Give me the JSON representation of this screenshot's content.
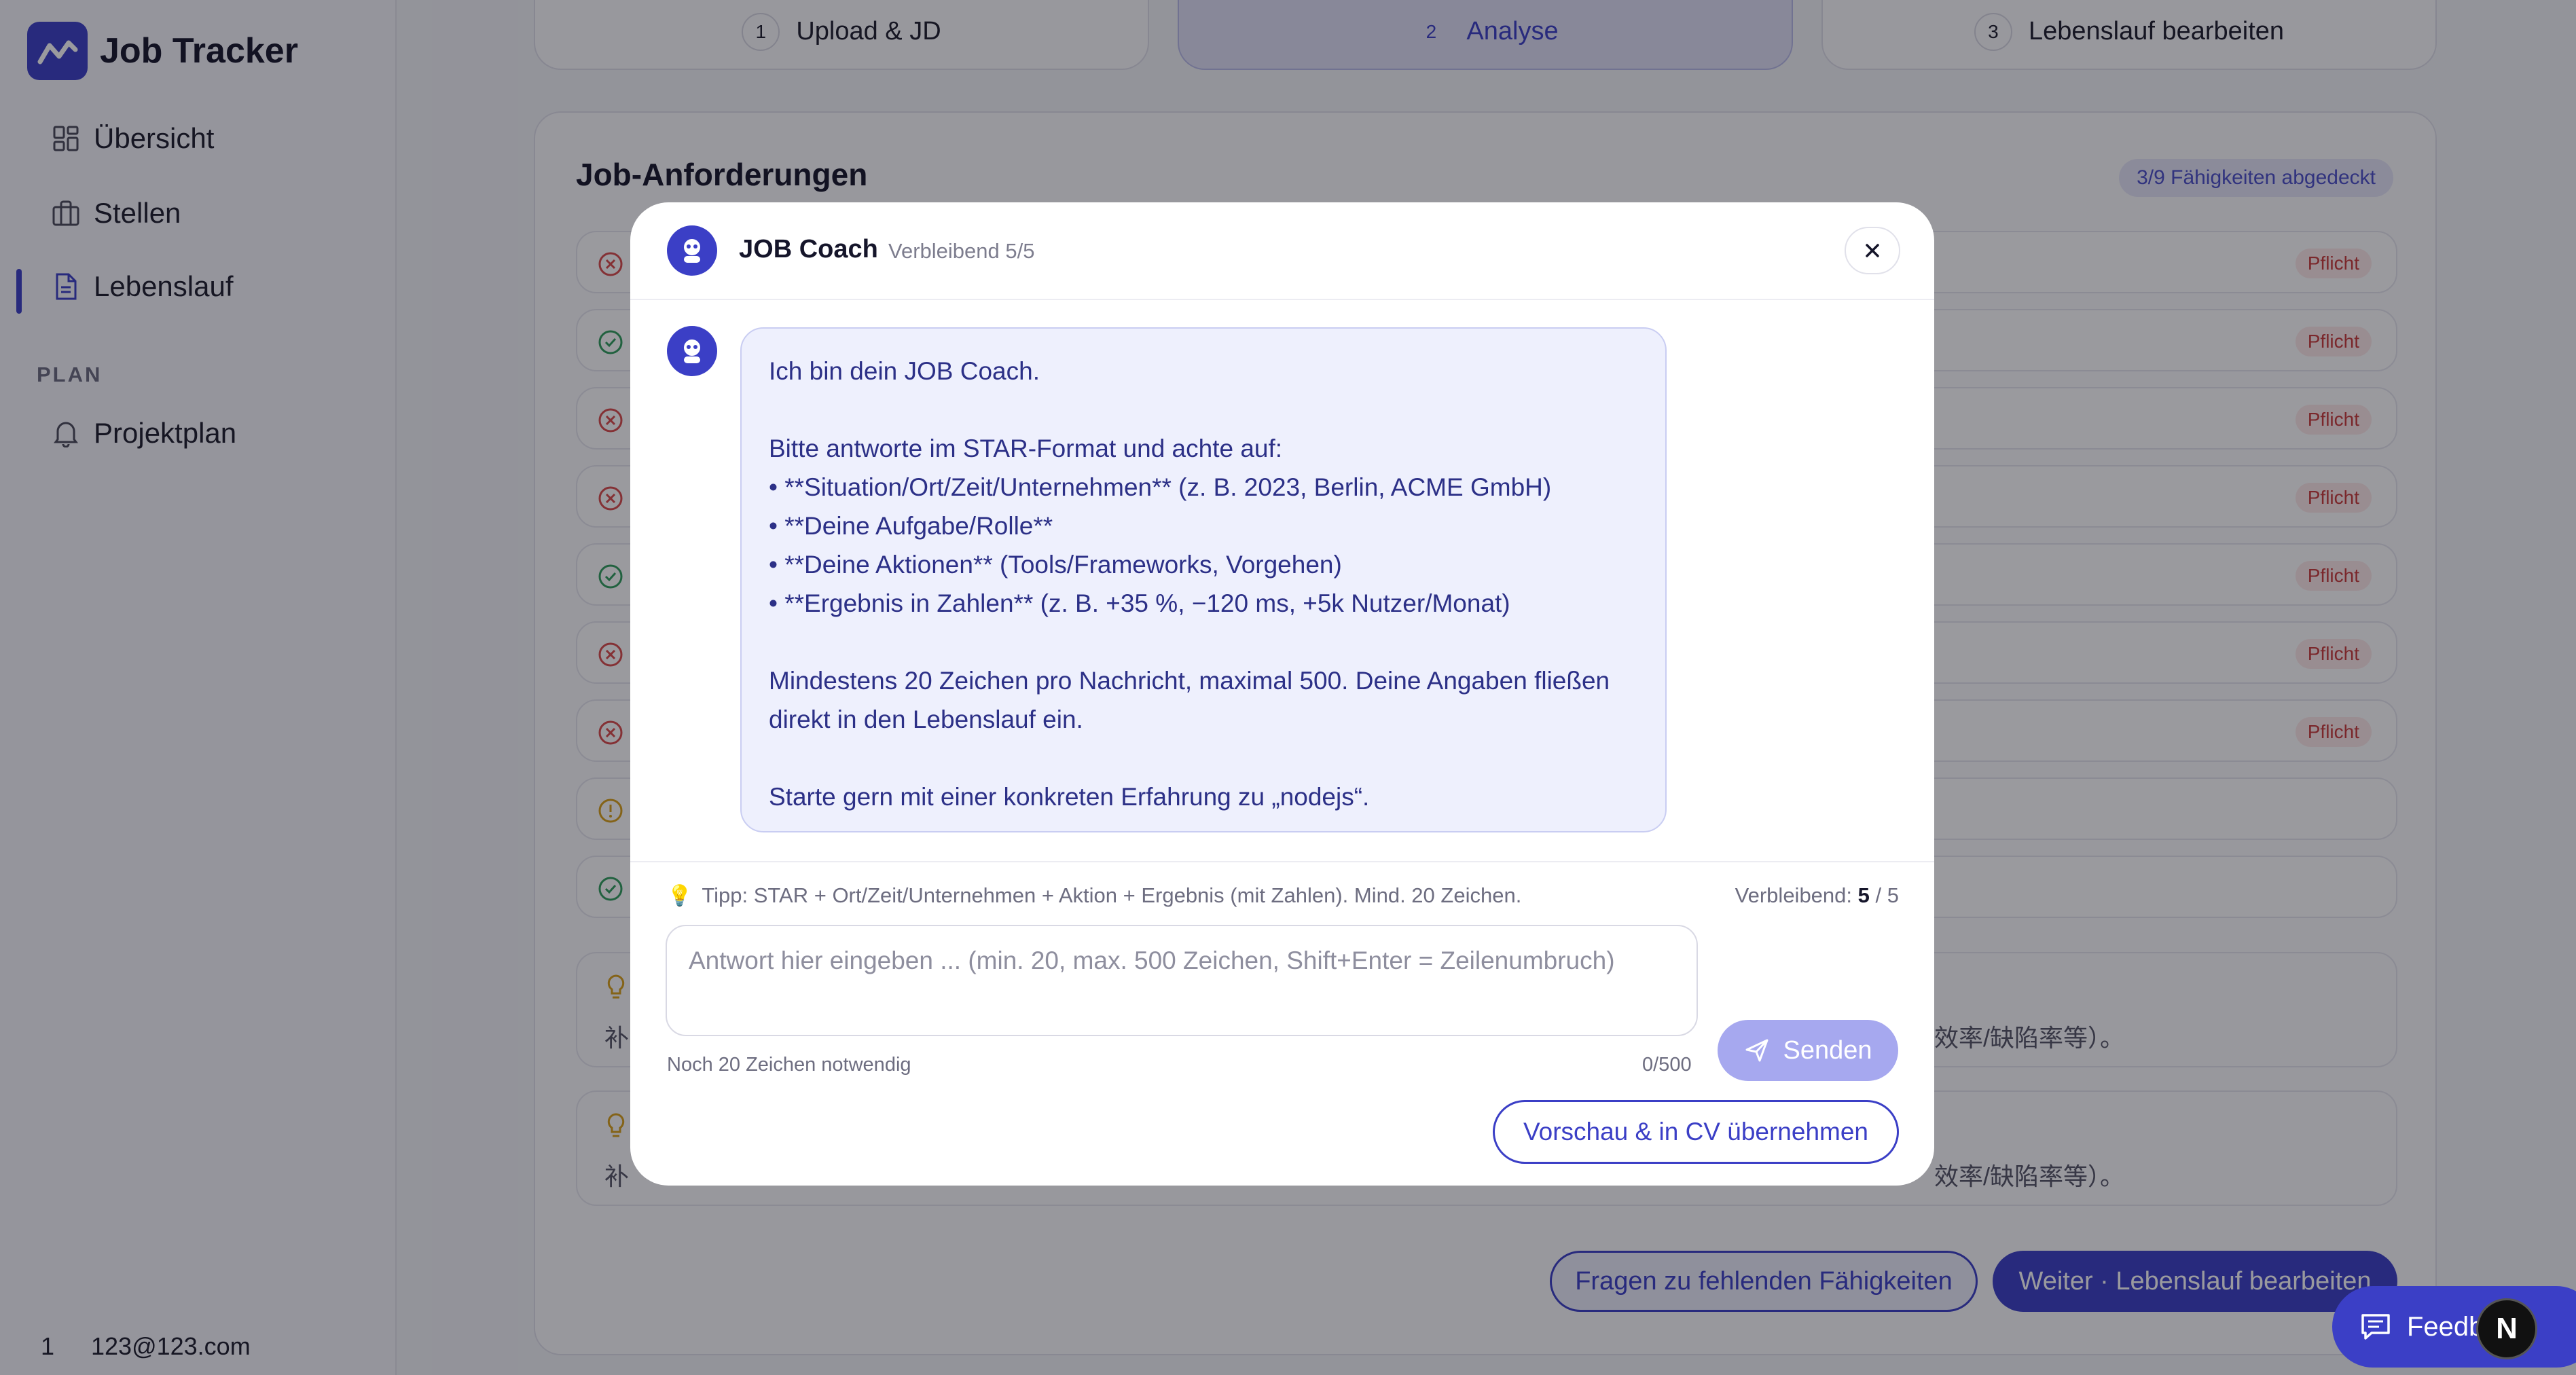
{
  "app": {
    "name": "Job Tracker"
  },
  "sidebar": {
    "items": [
      {
        "label": "Übersicht",
        "icon": "dashboard-icon"
      },
      {
        "label": "Stellen",
        "icon": "briefcase-icon"
      },
      {
        "label": "Lebenslauf",
        "icon": "document-icon",
        "active": true
      }
    ],
    "section_label": "PLAN",
    "plan_items": [
      {
        "label": "Projektplan",
        "icon": "bell-icon"
      }
    ],
    "user": {
      "index": "1",
      "email": "123@123.com"
    }
  },
  "steps": [
    {
      "number": "1",
      "label": "Upload & JD"
    },
    {
      "number": "2",
      "label": "Analyse",
      "active": true
    },
    {
      "number": "3",
      "label": "Lebenslauf bearbeiten"
    }
  ],
  "requirements": {
    "title": "Job-Anforderungen",
    "coverage": "3/9 Fähigkeiten abgedeckt",
    "badge_label": "Pflicht",
    "rows": [
      {
        "status": "missing",
        "badge": true
      },
      {
        "status": "covered",
        "badge": true
      },
      {
        "status": "missing",
        "badge": true
      },
      {
        "status": "missing",
        "badge": true
      },
      {
        "status": "covered",
        "badge": true
      },
      {
        "status": "missing",
        "badge": true
      },
      {
        "status": "missing",
        "badge": true
      },
      {
        "status": "partial",
        "badge": false
      },
      {
        "status": "covered",
        "badge": false
      }
    ],
    "hints": [
      {
        "text_start": "补",
        "text_end": "效率/缺陷率等）。"
      },
      {
        "text_start": "补",
        "text_end": "效率/缺陷率等）。"
      }
    ],
    "buttons": {
      "missing_skills": "Fragen zu fehlenden Fähigkeiten",
      "next": "Weiter · Lebenslauf bearbeiten"
    }
  },
  "modal": {
    "title": "JOB Coach",
    "remaining": "Verbleibend 5/5",
    "message": {
      "intro": "Ich bin dein JOB Coach.",
      "instruction": "Bitte antworte im STAR-Format und achte auf:",
      "bullets": [
        "• **Situation/Ort/Zeit/Unternehmen** (z. B. 2023, Berlin, ACME GmbH)",
        "• **Deine Aufgabe/Rolle**",
        "• **Deine Aktionen** (Tools/Frameworks, Vorgehen)",
        "• **Ergebnis in Zahlen** (z. B. +35 %, −120 ms, +5k Nutzer/Monat)"
      ],
      "limits": "Mindestens 20 Zeichen pro Nachricht, maximal 500. Deine Angaben fließen direkt in den Lebenslauf ein.",
      "closing": "Starte gern mit einer konkreten Erfahrung zu „nodejs“."
    },
    "tip": "Tipp: STAR + Ort/Zeit/Unternehmen + Aktion + Ergebnis (mit Zahlen). Mind. 20 Zeichen.",
    "remaining_label": "Verbleibend:",
    "remaining_used": "5",
    "remaining_sep": "/ 5",
    "input_placeholder": "Antwort hier eingeben ... (min. 20, max. 500 Zeichen, Shift+Enter = Zeilenumbruch)",
    "input_value": "",
    "char_hint": "Noch 20 Zeichen notwendig",
    "char_count": "0/500",
    "send_label": "Senden",
    "preview_label": "Vorschau & in CV übernehmen"
  },
  "floating": {
    "feedback_label": "Feedb",
    "badge_letter": "N"
  },
  "colors": {
    "accent": "#3b3fc6",
    "missing": "#d94b4b",
    "covered": "#2f9e5c",
    "partial": "#d9a019",
    "overlay": "rgba(14,14,24,0.42)"
  }
}
